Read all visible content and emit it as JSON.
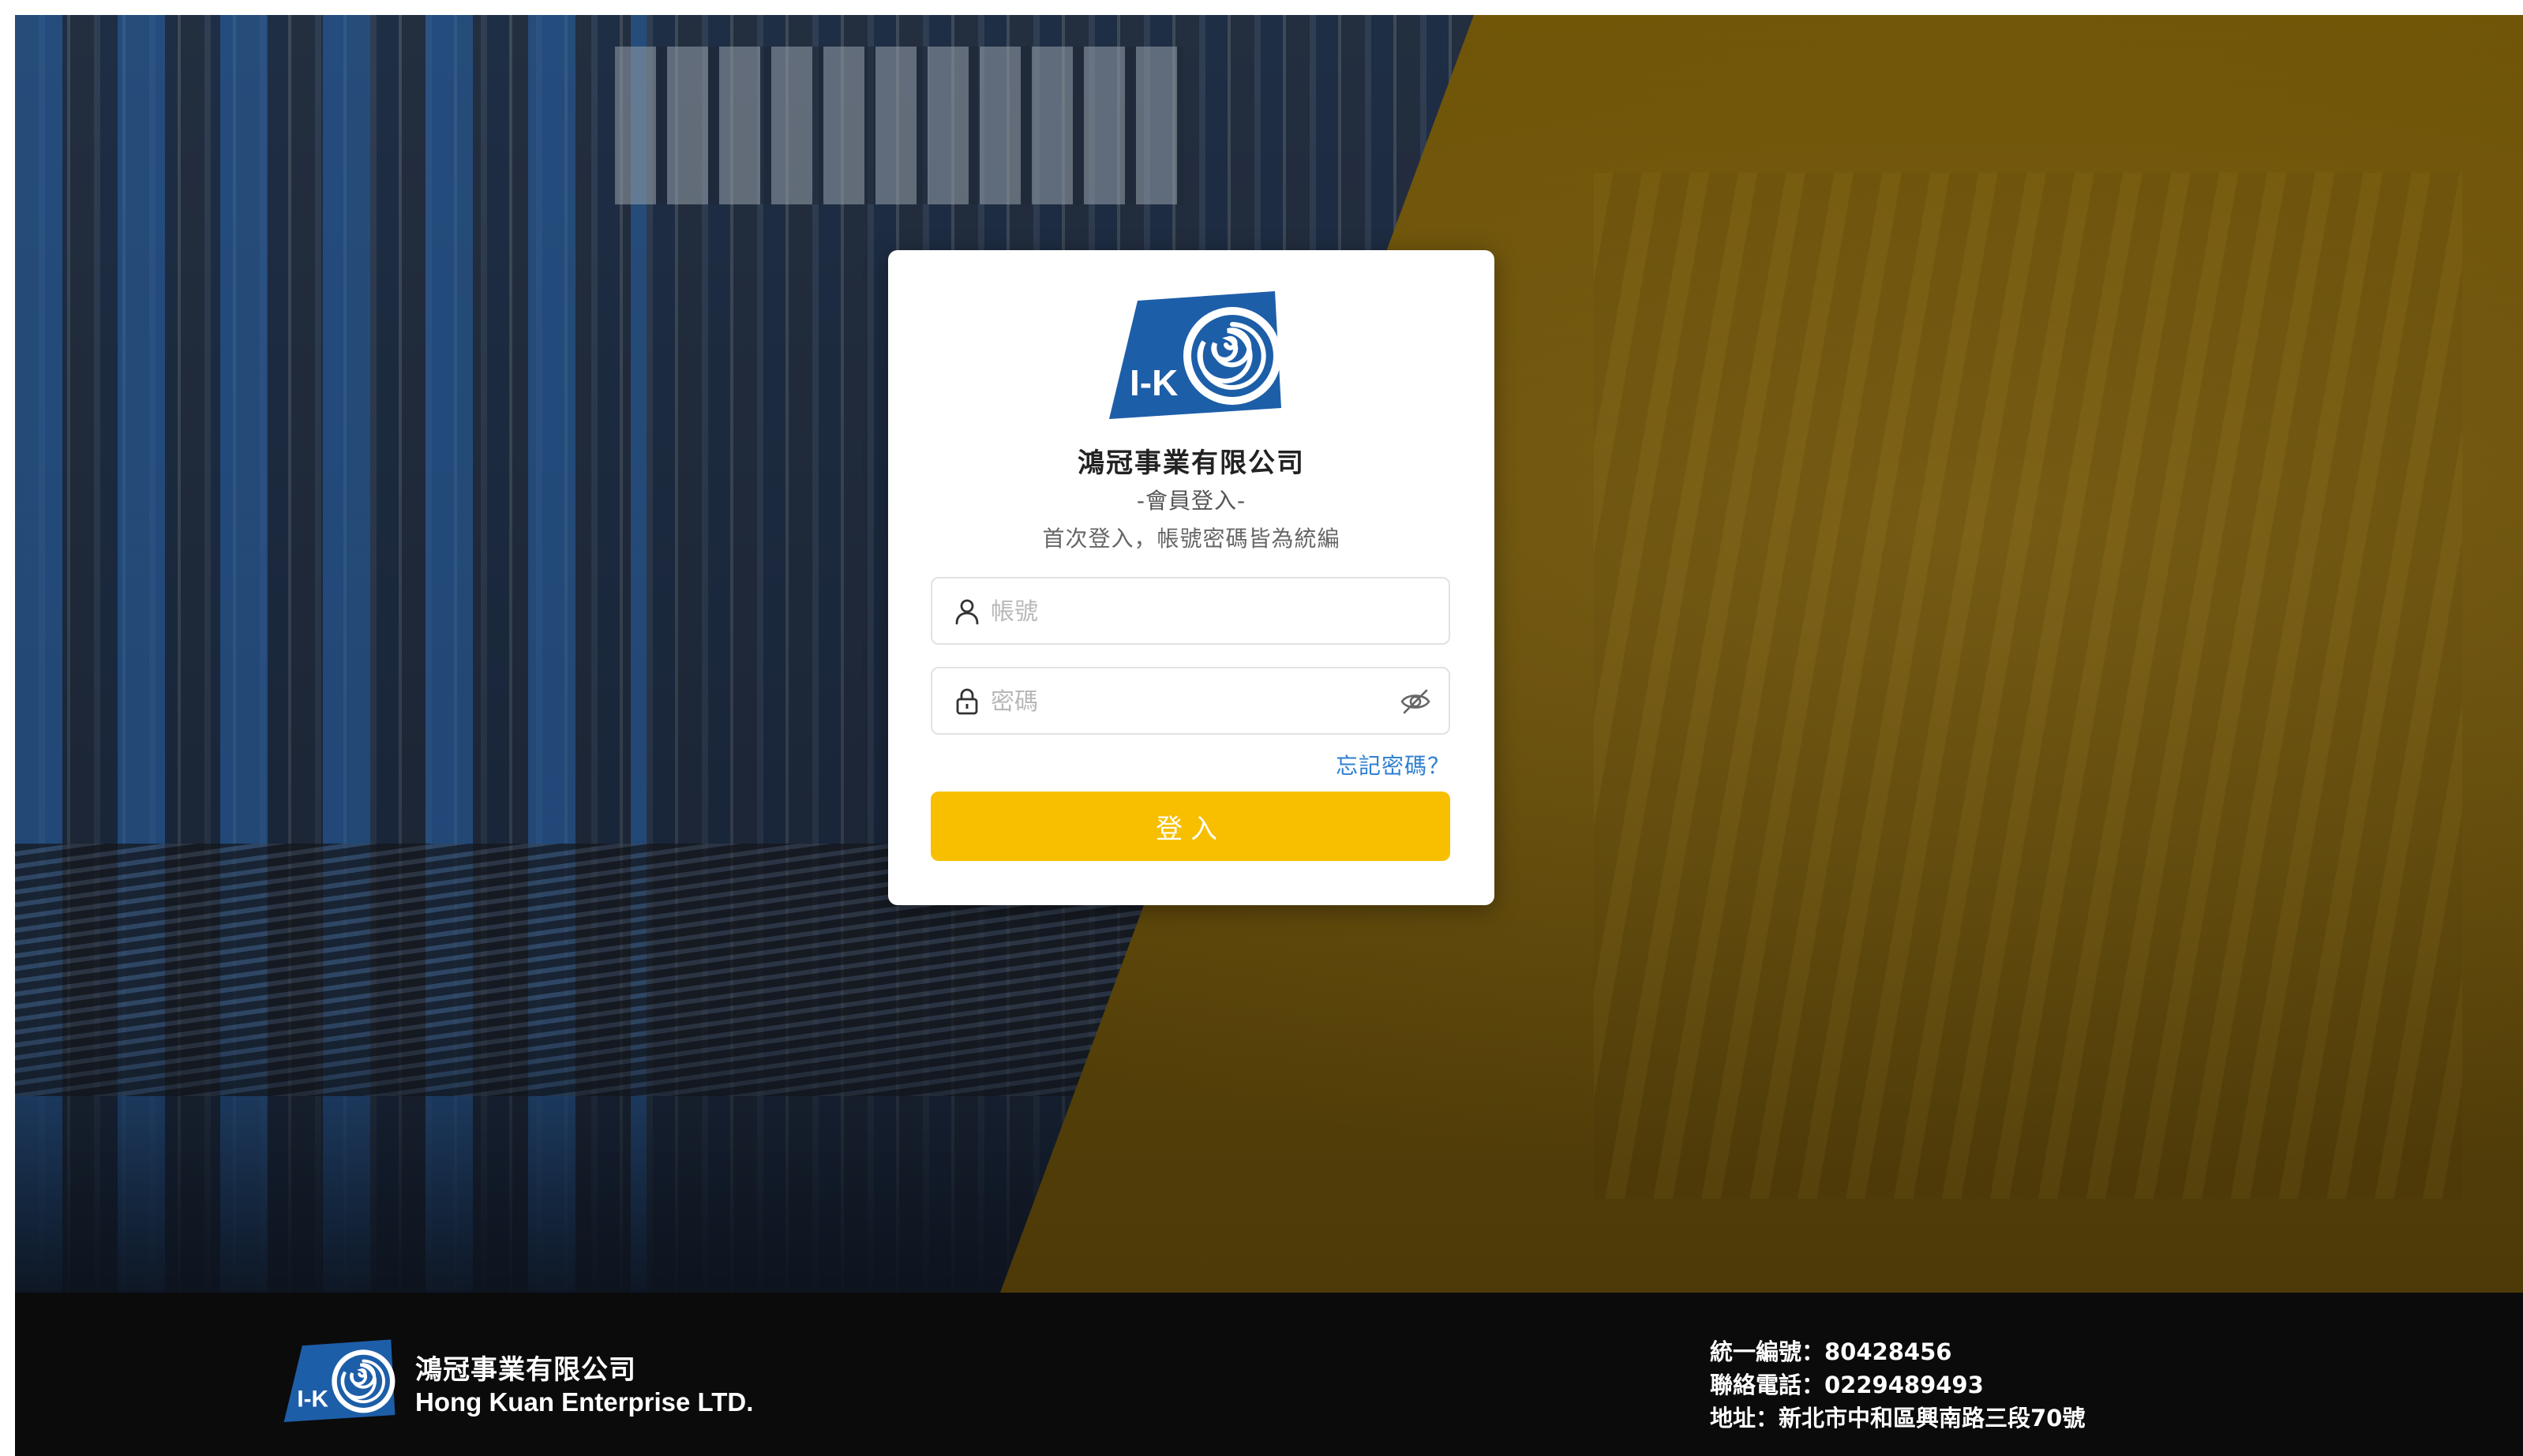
{
  "login": {
    "company_name": "鴻冠事業有限公司",
    "subtitle": "-會員登入-",
    "hint": "首次登入，帳號密碼皆為統編",
    "account_placeholder": "帳號",
    "password_placeholder": "密碼",
    "forgot_label": "忘記密碼？",
    "login_label": "登入",
    "account_icon": "user-icon",
    "password_icon": "lock-icon",
    "toggle_icon": "eye-off-icon"
  },
  "logo": {
    "text": "I-K"
  },
  "footer": {
    "company_zh": "鴻冠事業有限公司",
    "company_en": "Hong Kuan Enterprise LTD.",
    "tax_id": "統一編號：80428456",
    "phone": "聯絡電話：0229489493",
    "address": "地址：新北市中和區興南路三段70號"
  },
  "colors": {
    "accent_yellow": "#f7bf00",
    "link_blue": "#2f7fd0",
    "logo_blue": "#1d5ea8",
    "footer_bg": "#0b0b0b"
  }
}
